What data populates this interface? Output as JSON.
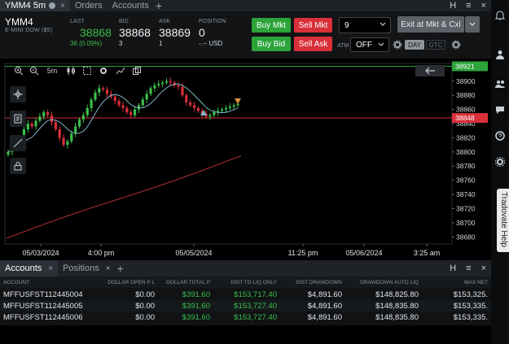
{
  "top_tabs": [
    {
      "label": "YMM4 5m",
      "active": true
    },
    {
      "label": "Orders"
    },
    {
      "label": "Accounts"
    }
  ],
  "window_controls": [
    "H",
    "≡",
    "×"
  ],
  "quote": {
    "symbol": "YMM4",
    "description": "E-MINI DOW ($5)",
    "last_label": "LAST",
    "last_value": "38868",
    "last_change": "36 (0.09%)",
    "bid_label": "BID",
    "bid_value": "38868",
    "bid_size": "3",
    "ask_label": "ASK",
    "ask_value": "38869",
    "ask_size": "1",
    "position_label": "POSITION",
    "position_value": "0",
    "position_pnl": "-.-- USD"
  },
  "order": {
    "buy_mkt": "Buy Mkt",
    "sell_mkt": "Sell Mkt",
    "buy_bid": "Buy Bid",
    "sell_ask": "Sell Ask",
    "quantity": "9",
    "exit_label": "Exit at Mkt & Cxl",
    "atm_label": "ATM",
    "atm_value": "OFF",
    "tif_day": "DAY",
    "tif_gtc": "GTC"
  },
  "chart_toolbar": {
    "timeframe": "5m"
  },
  "chart_data": {
    "type": "candlestick",
    "y_ticks": [
      38900,
      38880,
      38860,
      38840,
      38820,
      38800,
      38780,
      38760,
      38740,
      38720,
      38700,
      38680
    ],
    "ylim": [
      38670,
      38925
    ],
    "x_ticks": [
      "05/03/2024",
      "4:00 pm",
      "05/05/2024",
      "11:25 pm",
      "05/06/2024",
      "3:25 am"
    ],
    "last_price_label": "38848",
    "high_line_label": "38921",
    "candles_close": [
      38800,
      38806,
      38812,
      38818,
      38832,
      38840,
      38836,
      38844,
      38850,
      38856,
      38852,
      38842,
      38832,
      38820,
      38810,
      38815,
      38826,
      38836,
      38846,
      38852,
      38862,
      38874,
      38884,
      38890,
      38888,
      38882,
      38878,
      38872,
      38866,
      38862,
      38856,
      38852,
      38860,
      38866,
      38874,
      38882,
      38890,
      38894,
      38896,
      38898,
      38900,
      38898,
      38894,
      38892,
      38880,
      38870,
      38866,
      38862,
      38858,
      38854,
      38850,
      38852,
      38856,
      38858,
      38860,
      38862,
      38864,
      38866,
      38868
    ]
  },
  "bottom_tabs": [
    {
      "label": "Accounts",
      "active": true
    },
    {
      "label": "Positions"
    }
  ],
  "accounts_table": {
    "headers": [
      "ACCOUNT",
      "DOLLAR OPEN P L",
      "DOLLAR TOTAL P",
      "DIST TO LIQ ONLY",
      "DIST DRAWDOWN",
      "DRAWDOWN AUTO LIQ",
      "MAX NET"
    ],
    "rows": [
      [
        "MFFUSFST112445004",
        "$0.00",
        "$391.60",
        "$153,717.40",
        "$4,891.60",
        "$148,825.80",
        "$153,325."
      ],
      [
        "MFFUSFST112445005",
        "$0.00",
        "$391.60",
        "$153,727.40",
        "$4,891.60",
        "$148,835.80",
        "$153,335."
      ],
      [
        "MFFUSFST112445006",
        "$0.00",
        "$391.60",
        "$153,727.40",
        "$4,891.60",
        "$148,835.80",
        "$153,335."
      ]
    ]
  },
  "help": {
    "label": "Tradovate Help"
  },
  "colors": {
    "buy": "#2ca43a",
    "sell": "#d9303a",
    "up": "#3bbf4a",
    "down": "#d9303a",
    "ma_fast": "#7fb3c8",
    "ma_slow": "#b03030"
  }
}
